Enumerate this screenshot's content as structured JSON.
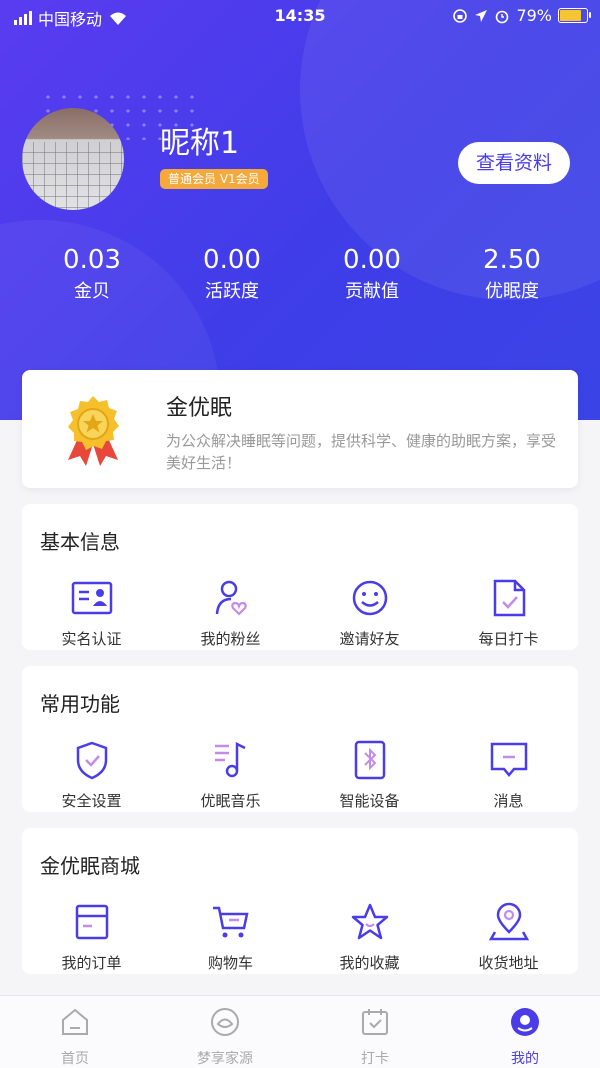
{
  "status_bar": {
    "carrier": "中国移动",
    "time": "14:35",
    "battery": "79%"
  },
  "profile": {
    "nickname": "昵称1",
    "member_level": "普通会员 V1会员",
    "view_button": "查看资料"
  },
  "stats": [
    {
      "value": "0.03",
      "label": "金贝"
    },
    {
      "value": "0.00",
      "label": "活跃度"
    },
    {
      "value": "0.00",
      "label": "贡献值"
    },
    {
      "value": "2.50",
      "label": "优眠度"
    }
  ],
  "intro": {
    "title": "金优眠",
    "desc": "为公众解决睡眠等问题，提供科学、健康的助眠方案，享受美好生活！"
  },
  "sections": [
    {
      "title": "基本信息",
      "items": [
        {
          "label": "实名认证",
          "icon": "id-card-icon"
        },
        {
          "label": "我的粉丝",
          "icon": "fans-icon"
        },
        {
          "label": "邀请好友",
          "icon": "smile-icon"
        },
        {
          "label": "每日打卡",
          "icon": "checkin-doc-icon"
        }
      ]
    },
    {
      "title": "常用功能",
      "items": [
        {
          "label": "安全设置",
          "icon": "shield-icon"
        },
        {
          "label": "优眠音乐",
          "icon": "music-icon"
        },
        {
          "label": "智能设备",
          "icon": "bluetooth-device-icon"
        },
        {
          "label": "消息",
          "icon": "message-icon"
        }
      ]
    },
    {
      "title": "金优眠商城",
      "items": [
        {
          "label": "我的订单",
          "icon": "order-icon"
        },
        {
          "label": "购物车",
          "icon": "cart-icon"
        },
        {
          "label": "我的收藏",
          "icon": "star-icon"
        },
        {
          "label": "收货地址",
          "icon": "location-icon"
        }
      ]
    }
  ],
  "tabbar": [
    {
      "label": "首页",
      "icon": "home-icon",
      "active": false
    },
    {
      "label": "梦享家源",
      "icon": "dream-icon",
      "active": false
    },
    {
      "label": "打卡",
      "icon": "calendar-check-icon",
      "active": false
    },
    {
      "label": "我的",
      "icon": "profile-icon",
      "active": true
    }
  ],
  "colors": {
    "brand": "#4a3ce8",
    "badge": "#f4a93a",
    "gradient_start": "#5a3cf0",
    "gradient_end": "#3a44e6"
  }
}
